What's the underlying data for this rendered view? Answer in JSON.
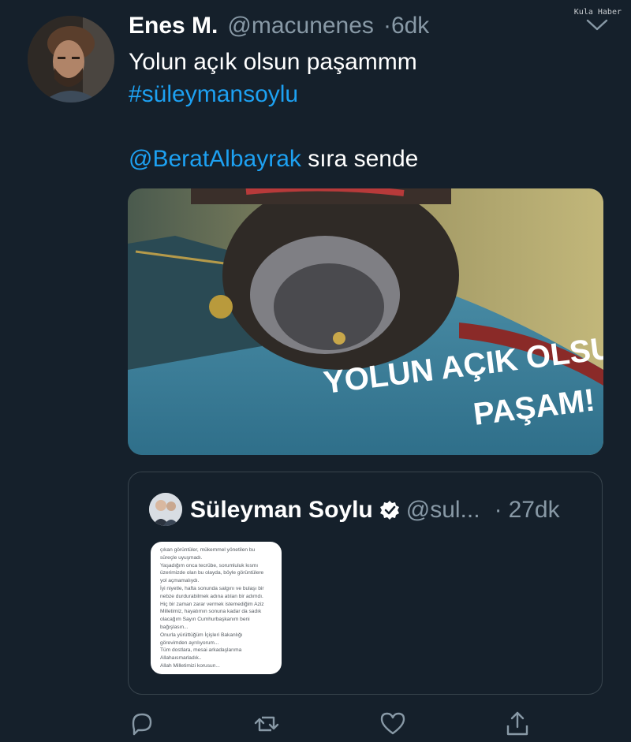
{
  "watermark": "Kula Haber",
  "tweet": {
    "author_name": "Enes M.",
    "author_handle": "@macunenes",
    "separator": "·",
    "time": "6dk",
    "text_lines": [
      [
        {
          "text": "Yolun açık olsun paşammm",
          "link": false
        }
      ],
      [
        {
          "text": "#süleymansoylu",
          "link": true
        }
      ],
      [],
      [
        {
          "text": "@BeratAlbayrak",
          "link": true
        },
        {
          "text": " sıra sende",
          "link": false
        }
      ]
    ],
    "media": {
      "overlay_line1": "YOLUN AÇIK OLSUN",
      "overlay_line2": "PAŞAM!"
    }
  },
  "quoted": {
    "author_name": "Süleyman Soylu",
    "author_handle": "@sul...",
    "separator": "·",
    "time": "27dk",
    "image_text": [
      "çıkan görüntüler, mükemmel yönetilen bu",
      "süreçle uyuşmadı.",
      "Yaşadığım onca tecrübe, sorumluluk kısmı",
      "üzerimizde olan bu olayda, böyle görüntülere",
      "yol açmamalıydı.",
      "İyi niyetle, hafta sonunda salgını ve bulaşı bir",
      "nebze durdurabilmek adına atılan bir adımdı.",
      "Hiç bir zaman zarar vermek istemediğim Aziz",
      "Milletimiz, hayatımın sonuna kadar da sadık",
      "olacağım Sayın Cumhurbaşkanım beni",
      "bağışlasın...",
      "Onurla yürüttüğüm İçişleri Bakanlığı",
      "görevimden ayrılıyorum...",
      "Tüm dostlara, mesai arkadaşlarıma",
      "Allahaısmarladık..",
      "Allah Milletimizi korusun..."
    ]
  },
  "colors": {
    "background": "#15202b",
    "link": "#1da1f2",
    "secondary_text": "#8899a6",
    "border": "#38444d"
  },
  "icons": [
    "chevron-down-icon",
    "verified-badge-icon",
    "reply-icon",
    "retweet-icon",
    "like-icon",
    "share-icon"
  ]
}
